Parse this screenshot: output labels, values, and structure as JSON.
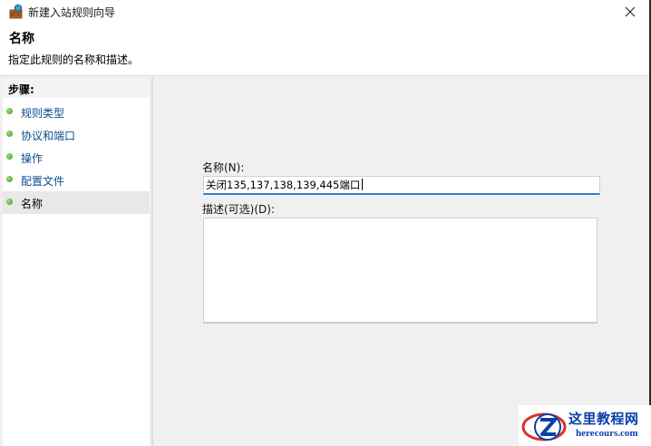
{
  "window": {
    "title": "新建入站规则向导",
    "close_icon": "close-icon"
  },
  "header": {
    "title": "名称",
    "subtitle": "指定此规则的名称和描述。"
  },
  "sidebar": {
    "heading": "步骤:",
    "items": [
      {
        "label": "规则类型",
        "active": false
      },
      {
        "label": "协议和端口",
        "active": false
      },
      {
        "label": "操作",
        "active": false
      },
      {
        "label": "配置文件",
        "active": false
      },
      {
        "label": "名称",
        "active": true
      }
    ]
  },
  "form": {
    "name_label": "名称(N):",
    "name_value": "关闭135,137,138,139,445端口",
    "description_label": "描述(可选)(D):",
    "description_value": ""
  },
  "watermark": {
    "chinese": "这里教程网",
    "url": "herecours.com"
  },
  "colors": {
    "link": "#0b4d8c",
    "accent": "#3a7bc8",
    "step_dot": "#3a9a1e",
    "watermark": "#0b3fa8"
  }
}
